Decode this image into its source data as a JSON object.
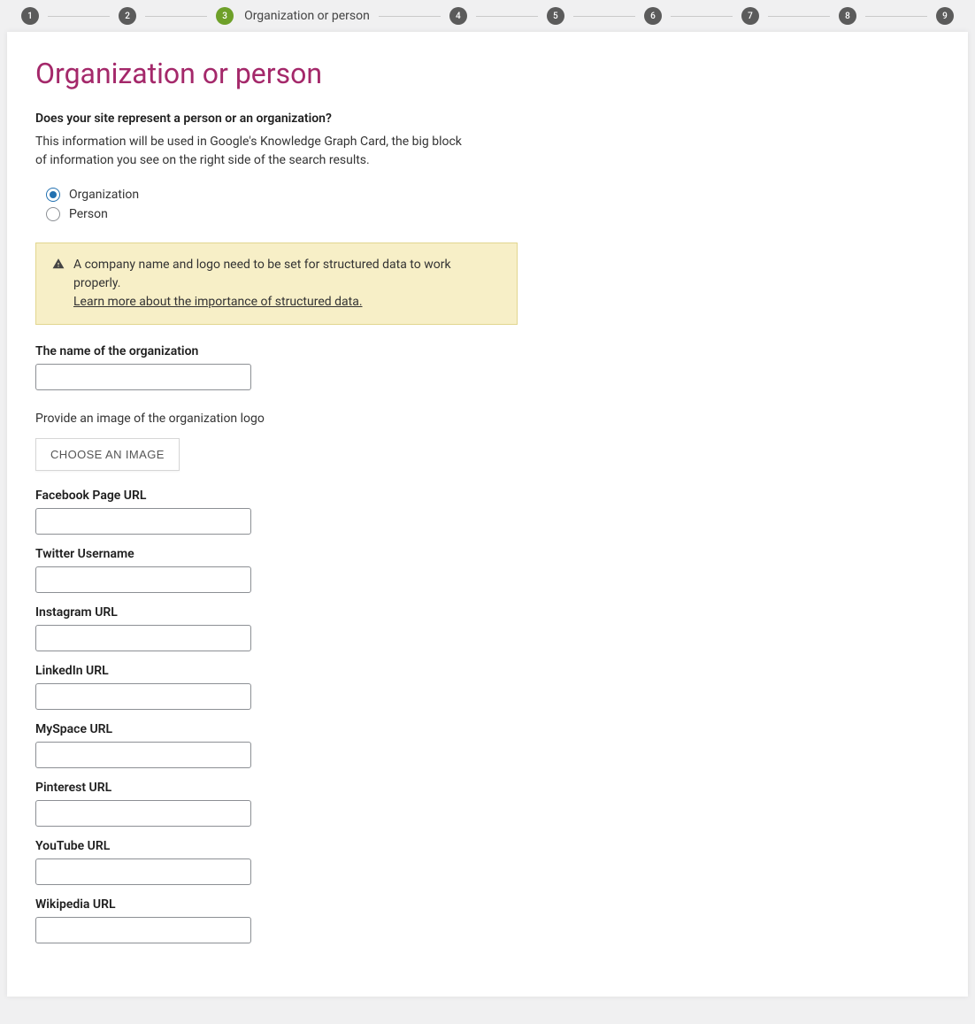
{
  "stepper": {
    "steps": [
      {
        "num": "1",
        "active": false,
        "label": ""
      },
      {
        "num": "2",
        "active": false,
        "label": ""
      },
      {
        "num": "3",
        "active": true,
        "label": "Organization or person"
      },
      {
        "num": "4",
        "active": false,
        "label": ""
      },
      {
        "num": "5",
        "active": false,
        "label": ""
      },
      {
        "num": "6",
        "active": false,
        "label": ""
      },
      {
        "num": "7",
        "active": false,
        "label": ""
      },
      {
        "num": "8",
        "active": false,
        "label": ""
      },
      {
        "num": "9",
        "active": false,
        "label": ""
      }
    ]
  },
  "page": {
    "title": "Organization or person",
    "question": "Does your site represent a person or an organization?",
    "description": "This information will be used in Google's Knowledge Graph Card, the big block of information you see on the right side of the search results."
  },
  "radio": {
    "option1": "Organization",
    "option2": "Person",
    "selected": "Organization"
  },
  "alert": {
    "text": "A company name and logo need to be set for structured data to work properly.",
    "link": "Learn more about the importance of structured data."
  },
  "fields": {
    "org_name_label": "The name of the organization",
    "logo_label": "Provide an image of the organization logo",
    "choose_button": "CHOOSE AN IMAGE",
    "facebook_label": "Facebook Page URL",
    "twitter_label": "Twitter Username",
    "instagram_label": "Instagram URL",
    "linkedin_label": "LinkedIn URL",
    "myspace_label": "MySpace URL",
    "pinterest_label": "Pinterest URL",
    "youtube_label": "YouTube URL",
    "wikipedia_label": "Wikipedia URL"
  }
}
